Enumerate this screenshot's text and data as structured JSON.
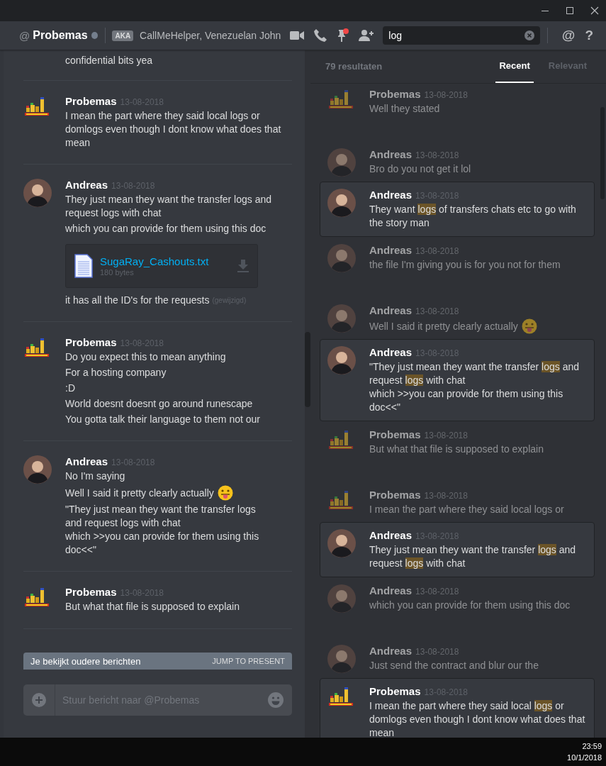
{
  "header": {
    "prefix": "@",
    "name": "Probemas",
    "online": false,
    "aka_badge": "AKA",
    "aliases": "CallMeHelper, Venezuelan John",
    "pin_notification": true,
    "search": {
      "value": "log"
    },
    "mention_button": "@",
    "help_button": "?"
  },
  "chat": {
    "top_fragment": "confidential bits yea",
    "messages": [
      {
        "author": "Probemas",
        "avatar": {
          "kind": "logo"
        },
        "date": "13-08-2018",
        "lines": [
          {
            "text": "I mean the part where they said local logs or domlogs even though I dont know what does that mean"
          }
        ]
      },
      {
        "author": "Andreas",
        "avatar": {
          "kind": "person"
        },
        "date": "13-08-2018",
        "lines": [
          {
            "text": "They just mean they want the transfer logs and request logs with chat"
          },
          {
            "text": "which you can provide for them using this doc"
          }
        ],
        "attachment": {
          "name": "SugaRay_Cashouts.txt",
          "size": "180 bytes"
        },
        "after": [
          {
            "text": "it has all the ID's for the requests",
            "edited": "(gewijzigd)"
          }
        ]
      },
      {
        "author": "Probemas",
        "avatar": {
          "kind": "logo"
        },
        "date": "13-08-2018",
        "lines": [
          {
            "text": "Do you expect this to mean anything"
          },
          {
            "text": "For a hosting company"
          },
          {
            "text": ":D"
          },
          {
            "text": "World doesnt doesnt go around runescape"
          },
          {
            "text": "You gotta talk their language to them not our"
          }
        ]
      },
      {
        "author": "Andreas",
        "avatar": {
          "kind": "person"
        },
        "date": "13-08-2018",
        "lines": [
          {
            "text": "No I'm saying"
          },
          {
            "text": "Well I said it pretty clearly actually",
            "emoji": true
          },
          {
            "text": "\"They just mean they want the transfer logs\nand request logs with chat\nwhich >>you can provide for them using this doc<<\""
          }
        ]
      },
      {
        "author": "Probemas",
        "avatar": {
          "kind": "logo"
        },
        "date": "13-08-2018",
        "lines": [
          {
            "text": "But what that file is supposed to explain"
          }
        ]
      }
    ],
    "banner": {
      "text": "Je bekijkt oudere berichten",
      "action": "JUMP TO PRESENT"
    },
    "composer": {
      "placeholder": "Stuur bericht naar @Probemas"
    }
  },
  "results": {
    "count": "79 resultaten",
    "tabs": [
      {
        "label": "Recent",
        "selected": true
      },
      {
        "label": "Relevant",
        "selected": false
      }
    ],
    "items": [
      {
        "kind": "context",
        "author": "Probemas",
        "avatar": {
          "kind": "logo"
        },
        "date": "13-08-2018",
        "text": "Well they stated"
      },
      {
        "kind": "context",
        "author": "Andreas",
        "avatar": {
          "kind": "person"
        },
        "date": "13-08-2018",
        "text": "Bro do you not get it lol"
      },
      {
        "kind": "hit",
        "author": "Andreas",
        "avatar": {
          "kind": "person"
        },
        "date": "13-08-2018",
        "text": "They want **logs** of transfers chats etc to go with the story man"
      },
      {
        "kind": "context",
        "author": "Andreas",
        "avatar": {
          "kind": "person"
        },
        "date": "13-08-2018",
        "text": "the file I'm giving you is for you not for them"
      },
      {
        "kind": "context",
        "author": "Andreas",
        "avatar": {
          "kind": "person"
        },
        "date": "13-08-2018",
        "text": "Well I said it pretty clearly actually",
        "emoji": true
      },
      {
        "kind": "hit",
        "author": "Andreas",
        "avatar": {
          "kind": "person"
        },
        "date": "13-08-2018",
        "text": "\"They just mean they want the transfer **logs** and request **logs** with chat\nwhich >>you can provide for them using this doc<<\""
      },
      {
        "kind": "context",
        "author": "Probemas",
        "avatar": {
          "kind": "logo"
        },
        "date": "13-08-2018",
        "text": "But what that file is supposed to explain"
      },
      {
        "kind": "context",
        "author": "Probemas",
        "avatar": {
          "kind": "logo"
        },
        "date": "13-08-2018",
        "text": "I mean the part where they said local logs or"
      },
      {
        "kind": "hit",
        "author": "Andreas",
        "avatar": {
          "kind": "person"
        },
        "date": "13-08-2018",
        "text": "They just mean they want the transfer **logs** and request **logs** with chat"
      },
      {
        "kind": "context",
        "author": "Andreas",
        "avatar": {
          "kind": "person"
        },
        "date": "13-08-2018",
        "text": "which you can provide for them using this doc"
      },
      {
        "kind": "context",
        "author": "Andreas",
        "avatar": {
          "kind": "person"
        },
        "date": "13-08-2018",
        "text": "Just send the contract and blur our the"
      },
      {
        "kind": "hit",
        "author": "Probemas",
        "avatar": {
          "kind": "logo"
        },
        "date": "13-08-2018",
        "text": "I mean the part where they said local **logs** or domlogs even though I dont know what does that mean"
      }
    ]
  },
  "taskbar": {
    "time": "23:59",
    "date": "10/1/2018"
  }
}
